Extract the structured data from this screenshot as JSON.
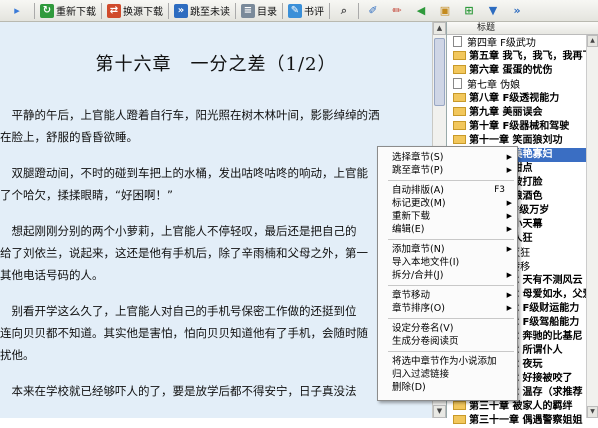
{
  "toolbar": {
    "items": [
      {
        "label": "",
        "icon": "arrow-icon"
      },
      {
        "label": "重新下载",
        "icon": "download-icon"
      },
      {
        "label": "换源下载",
        "icon": "switch-source-icon"
      },
      {
        "label": "跳至未读",
        "icon": "jump-icon"
      },
      {
        "label": "目录",
        "icon": "list-icon"
      },
      {
        "label": "书评",
        "icon": "review-icon"
      }
    ],
    "extra_icons": [
      "search-icon",
      "pen-icon",
      "volume-icon",
      "book-icon",
      "window-icon",
      "arrow-down-icon",
      "forward-icon"
    ]
  },
  "reader": {
    "chapter_title": "第十六章　一分之差（1/2）",
    "lines": [
      "　平静的午后，上官能人蹬着自行车，阳光照在树木林叶间，影影绰绰的洒",
      "在脸上，舒服的昏昏欲睡。",
      "　双腿蹬动间，不时的碰到车把上的水桶，发出咕咚咕咚的响动，上官能",
      "了个哈欠，揉揉眼睛，“好困啊！”",
      "　想起刚刚分别的两个小萝莉，上官能人不停轻叹，最后还是把自己的",
      "给了刘依兰，说起来，这还是他有手机后，除了辛雨楠和父母之外，第一",
      "其他电话号码的人。",
      "　别看开学这么久了，上官能人对自己的手机号保密工作做的还挺到位",
      "连向贝贝都不知道。其实他是害怕，怕向贝贝知道他有了手机，会随时随",
      "扰他。",
      "　本来在学校就已经够吓人的了，要是放学后都不得安宁，日子真没法"
    ]
  },
  "sidebar": {
    "header": "标题",
    "rows": [
      {
        "text": "第四章 F级武功",
        "style": "normal"
      },
      {
        "text": "第五章 我飞，我飞，我再飞",
        "style": "bold"
      },
      {
        "text": "第六章 蛋蛋的忧伤",
        "style": "bold"
      },
      {
        "text": "第七章 伪娘",
        "style": "normal"
      },
      {
        "text": "第八章 F级透视能力",
        "style": "bold"
      },
      {
        "text": "第九章 美丽误会",
        "style": "bold"
      },
      {
        "text": "第十章 F级器械和驾驶",
        "style": "bold"
      },
      {
        "text": "第十一章 笑面狼刘功",
        "style": "bold"
      },
      {
        "text": "第十二章 美艳寡妇",
        "style": "selected"
      },
      {
        "text": "第十三章 甜点",
        "style": "bold"
      },
      {
        "text": "第十四章 被打脸",
        "style": "bold"
      },
      {
        "text": "第十五章 酿酒色",
        "style": "bold"
      },
      {
        "text": "第十六章 F级万岁",
        "style": "bold"
      },
      {
        "text": "第十七章 小天幕",
        "style": "bold"
      },
      {
        "text": "第十八章 人狂",
        "style": "bold"
      },
      {
        "text": "第十九章 灭狂",
        "style": "normal"
      },
      {
        "text": "第二十章 转移",
        "style": "normal"
      },
      {
        "text": "第二十一章 天有不测风云",
        "style": "bold"
      },
      {
        "text": "第二十二章 母爱如水，父爱",
        "style": "bold"
      },
      {
        "text": "第二十三章 F级财运能力",
        "style": "bold"
      },
      {
        "text": "第二十四章 F级驾船能力",
        "style": "bold"
      },
      {
        "text": "第二十五章 奔驰的比基尼",
        "style": "bold"
      },
      {
        "text": "第二十六章 所谓仆人",
        "style": "bold"
      },
      {
        "text": "第二十七章 夜玩",
        "style": "bold"
      },
      {
        "text": "第二十八章 好接被咬了",
        "style": "bold"
      },
      {
        "text": "第二十九章 温存（求推荐",
        "style": "bold"
      },
      {
        "text": "第三十章 被家人的羁绊",
        "style": "bold"
      },
      {
        "text": "第三十一章 偶遇警察姐姐",
        "style": "bold"
      }
    ]
  },
  "context_menu": {
    "items": [
      {
        "label": "选择章节",
        "hotkey": "S",
        "submenu": true
      },
      {
        "label": "跳至章节",
        "hotkey": "P",
        "submenu": true
      },
      {
        "sep": true
      },
      {
        "label": "自动排版",
        "hotkey": "A",
        "shortcut": "F3"
      },
      {
        "label": "标记更改",
        "hotkey": "M",
        "submenu": true
      },
      {
        "label": "重新下载",
        "hotkey": "",
        "submenu": true
      },
      {
        "label": "编辑",
        "hotkey": "E",
        "submenu": true
      },
      {
        "sep": true
      },
      {
        "label": "添加章节",
        "hotkey": "N",
        "submenu": true
      },
      {
        "label": "导入本地文件",
        "hotkey": "I",
        "submenu": false
      },
      {
        "label": "拆分/合并",
        "hotkey": "J",
        "submenu": true
      },
      {
        "sep": true
      },
      {
        "label": "章节移动",
        "hotkey": "",
        "submenu": true
      },
      {
        "label": "章节排序",
        "hotkey": "O",
        "submenu": true
      },
      {
        "sep": true
      },
      {
        "label": "设定分卷名",
        "hotkey": "V",
        "submenu": false
      },
      {
        "label": "生成分卷阅读页",
        "hotkey": "",
        "submenu": false
      },
      {
        "sep": true
      },
      {
        "label": "将选中章节作为小说添加",
        "hotkey": "",
        "submenu": false
      },
      {
        "label": "归入过滤链接",
        "hotkey": "",
        "submenu": false
      },
      {
        "label": "删除",
        "hotkey": "D",
        "submenu": false
      }
    ]
  },
  "colors": {
    "reader_bg": "#e3eef8",
    "selection": "#3a6ec3",
    "folder": "#f2c75c"
  }
}
